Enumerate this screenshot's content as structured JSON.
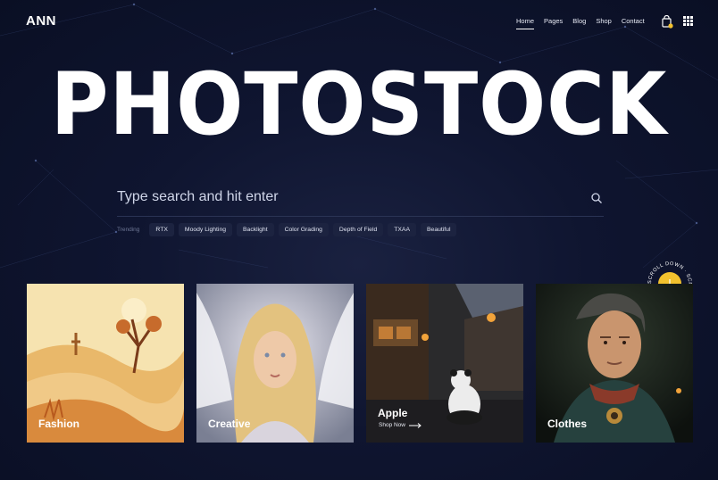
{
  "logo": "ANN",
  "nav": [
    "Home",
    "Pages",
    "Blog",
    "Shop",
    "Contact"
  ],
  "hero": {
    "title": "PHOTOSTOCK"
  },
  "search": {
    "placeholder": "Type search and hit enter"
  },
  "trending": {
    "label": "Trending",
    "tags": [
      "RTX",
      "Moody Lighting",
      "Backlight",
      "Color Grading",
      "Depth of Field",
      "TXAA",
      "Beautiful"
    ]
  },
  "scroll_badge": {
    "text": "SCROLL DOWN · SCROLL DOWN · "
  },
  "cards": [
    {
      "title": "Fashion"
    },
    {
      "title": "Creative"
    },
    {
      "title": "Apple",
      "cta": "Shop Now"
    },
    {
      "title": "Clothes"
    }
  ],
  "colors": {
    "background": "#0f1530",
    "accent": "#f2c12e",
    "tag_bg": "#1c2340"
  }
}
